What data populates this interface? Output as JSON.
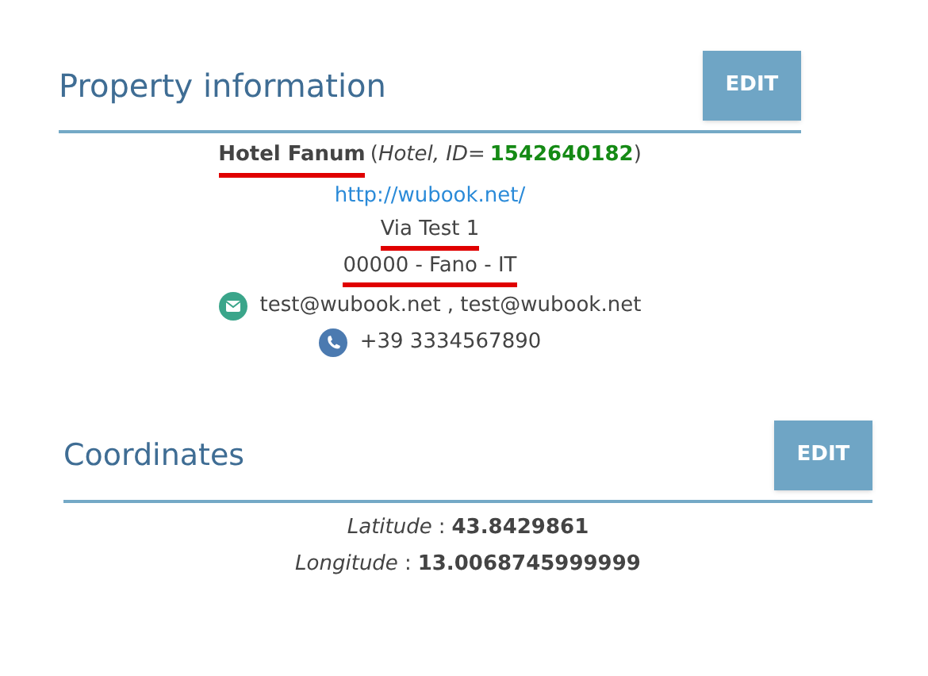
{
  "property": {
    "title": "Property information",
    "edit_button": "EDIT",
    "header": {
      "name": "Hotel Fanum",
      "name_marked": true,
      "paren_open": "(",
      "type": "Hotel, ID=",
      "id": "1542640182",
      "paren_close": ")"
    },
    "website": "http://wubook.net/",
    "address_lines": [
      {
        "text": "Via Test 1",
        "marked": true
      },
      {
        "text": "00000 - Fano - IT",
        "marked": true
      }
    ],
    "email": "test@wubook.net , test@wubook.net",
    "phone": "+39 3334567890"
  },
  "coordinates": {
    "title": "Coordinates",
    "edit_button": "EDIT",
    "items": [
      {
        "label": "Latitude",
        "separator": ":",
        "value": "43.8429861"
      },
      {
        "label": "Longitude",
        "separator": ":",
        "value": "13.0068745999999"
      }
    ]
  }
}
